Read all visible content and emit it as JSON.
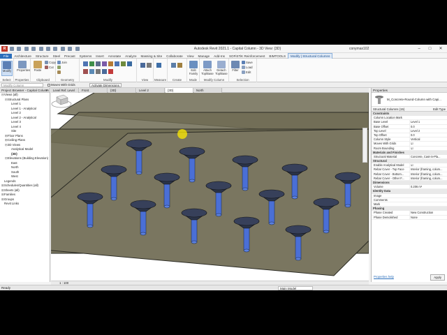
{
  "app": {
    "title": "Autodesk Revit 2021.1 - Capital Column - 3D View: {3D}",
    "user": "conymax102",
    "logo": "R"
  },
  "ribbon": {
    "tabs": [
      "File",
      "Architecture",
      "Structure",
      "Steel",
      "Precast",
      "Systems",
      "Insert",
      "Annotate",
      "Analyze",
      "Massing & Site",
      "Collaborate",
      "View",
      "Manage",
      "Add-Ins",
      "SOFiSTiK Reinforcement",
      "BIMTOOLS",
      "Modify | Structural Columns"
    ],
    "active_tab": "Modify | Structural Columns",
    "groups": {
      "select": "Select",
      "properties": "Properties",
      "clipboard": "Clipboard",
      "geometry": "Geometry",
      "modify": "Modify",
      "view": "View",
      "measure": "Measure",
      "create": "Create",
      "mode": "Mode",
      "modify_column": "Modify Column",
      "selection": "Selection"
    },
    "buttons": {
      "modify": "Modify",
      "properties": "Properties",
      "paste": "Paste",
      "copy": "Copy",
      "cut": "Cut",
      "join": "Join",
      "edit_family": "Edit Family",
      "attach": "Attach Top/Base",
      "detach": "Detach Top/Base",
      "filter": "Filter",
      "save": "Save",
      "load": "Load",
      "edit": "Edit"
    }
  },
  "options_bar": {
    "select_placeholder": "Modify Column",
    "moves_with_grids": "Moves With Grids",
    "activate_dimensions": "Activate Dimensions"
  },
  "project_browser": {
    "header": "Project Browser - Capital Column",
    "items": [
      {
        "label": "Views (all)",
        "indent": 0,
        "toggle": "⊟"
      },
      {
        "label": "Structural Plans",
        "indent": 1,
        "toggle": "⊟"
      },
      {
        "label": "Level 1",
        "indent": 2,
        "toggle": ""
      },
      {
        "label": "Level 1 - Analytical",
        "indent": 2,
        "toggle": ""
      },
      {
        "label": "Level 2",
        "indent": 2,
        "toggle": ""
      },
      {
        "label": "Level 2 - Analytical",
        "indent": 2,
        "toggle": ""
      },
      {
        "label": "Level 3",
        "indent": 2,
        "toggle": ""
      },
      {
        "label": "Level 4",
        "indent": 2,
        "toggle": ""
      },
      {
        "label": "Site",
        "indent": 2,
        "toggle": ""
      },
      {
        "label": "Floor Plans",
        "indent": 1,
        "toggle": "⊞"
      },
      {
        "label": "Ceiling Plans",
        "indent": 1,
        "toggle": "⊞"
      },
      {
        "label": "3D Views",
        "indent": 1,
        "toggle": "⊟"
      },
      {
        "label": "Analytical Model",
        "indent": 2,
        "toggle": ""
      },
      {
        "label": "{3D}",
        "indent": 2,
        "toggle": ""
      },
      {
        "label": "Elevations (Building Elevation)",
        "indent": 1,
        "toggle": "⊟"
      },
      {
        "label": "East",
        "indent": 2,
        "toggle": ""
      },
      {
        "label": "North",
        "indent": 2,
        "toggle": ""
      },
      {
        "label": "South",
        "indent": 2,
        "toggle": ""
      },
      {
        "label": "West",
        "indent": 2,
        "toggle": ""
      },
      {
        "label": "Legends",
        "indent": 0,
        "toggle": ""
      },
      {
        "label": "Schedules/Quantities (all)",
        "indent": 0,
        "toggle": "⊞"
      },
      {
        "label": "Sheets (all)",
        "indent": 0,
        "toggle": "⊞"
      },
      {
        "label": "Families",
        "indent": 0,
        "toggle": "⊞"
      },
      {
        "label": "Groups",
        "indent": 0,
        "toggle": "⊞"
      },
      {
        "label": "Revit Links",
        "indent": 0,
        "toggle": ""
      }
    ]
  },
  "view_tabs": [
    "Level Ref. Level",
    "Front",
    "{3D}",
    "Level 2",
    "{3D}",
    "North"
  ],
  "active_view_tab": 4,
  "view_control": {
    "scale": "1 : 100"
  },
  "properties": {
    "header": "Properties",
    "type_name": "M_Concrete-Round-Column with Capi...",
    "filter": "Structural Columns (15)",
    "edit_type": "Edit Type",
    "sections": [
      {
        "title": "Constraints",
        "rows": [
          [
            "Column Location Mark",
            ""
          ],
          [
            "Base Level",
            "Level 1"
          ],
          [
            "Base Offset",
            "0.0"
          ],
          [
            "Top Level",
            "Level 2"
          ],
          [
            "Top Offset",
            "0.0"
          ],
          [
            "Column Style",
            "Vertical"
          ],
          [
            "Moves With Grids",
            "☑"
          ],
          [
            "Room Bounding",
            "☑"
          ]
        ]
      },
      {
        "title": "Materials and Finishes",
        "rows": [
          [
            "Structural Material",
            "Concrete, Cast-in-Pla..."
          ]
        ]
      },
      {
        "title": "Structural",
        "rows": [
          [
            "Enable Analytical Model",
            "☑"
          ],
          [
            "Rebar Cover - Top Face",
            "Interior (framing, colum..."
          ],
          [
            "Rebar Cover - Bottom...",
            "Interior (framing, colum..."
          ],
          [
            "Rebar Cover - Other F...",
            "Interior (framing, colum..."
          ]
        ]
      },
      {
        "title": "Dimensions",
        "rows": [
          [
            "Volume",
            "0.206 m³"
          ]
        ]
      },
      {
        "title": "Identity Data",
        "rows": [
          [
            "Image",
            ""
          ],
          [
            "Comments",
            ""
          ],
          [
            "Mark",
            ""
          ]
        ]
      },
      {
        "title": "Phasing",
        "rows": [
          [
            "Phase Created",
            "New Construction"
          ],
          [
            "Phase Demolished",
            "None"
          ]
        ]
      }
    ],
    "help_link": "Properties help",
    "apply": "Apply"
  },
  "status": {
    "text": "Ready",
    "model": "Main Model"
  },
  "colors": {
    "slab": "#6f6b54",
    "slab_edge": "#2b2b24",
    "column": "#4a6fd6",
    "capital": "#2a3348",
    "selection": "#2a6ebb"
  }
}
